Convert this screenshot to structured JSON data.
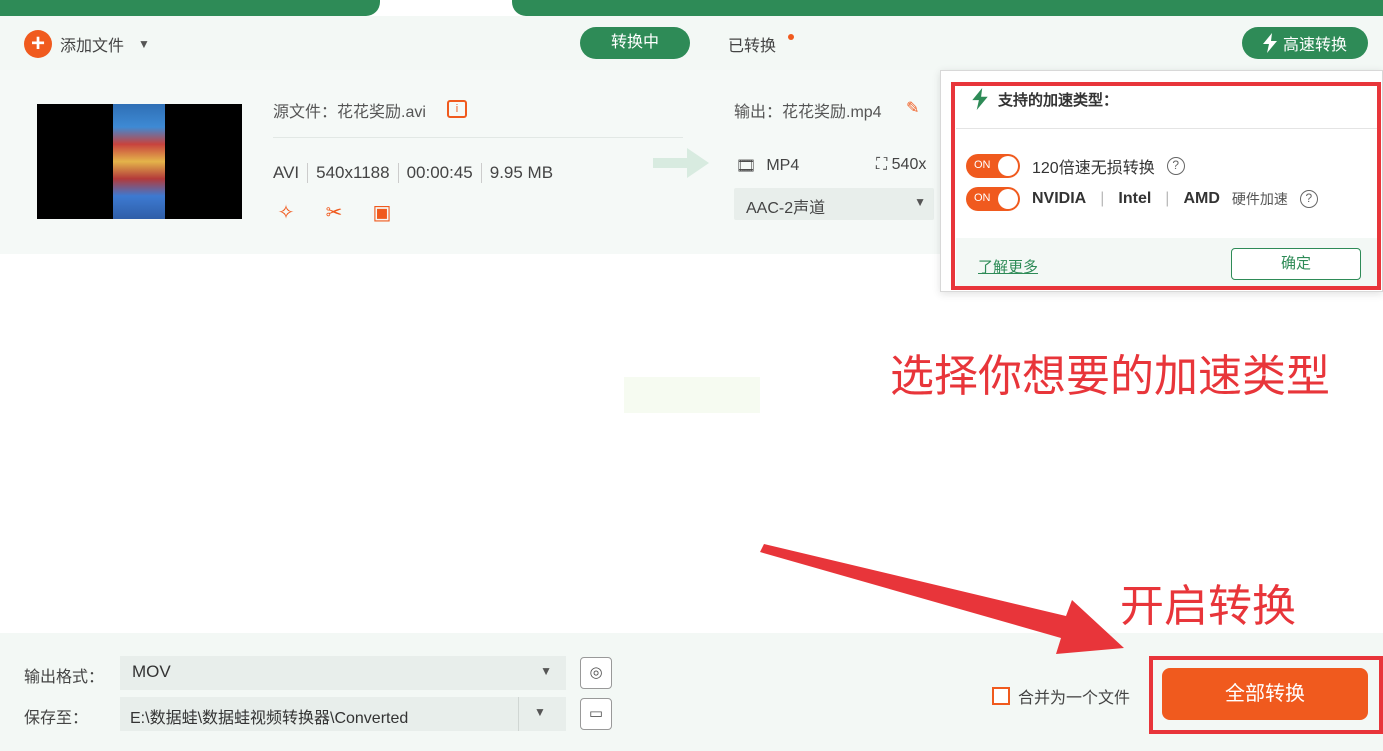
{
  "toolbar": {
    "add_file_label": "添加文件",
    "tab_converting": "转换中",
    "tab_converted": "已转换",
    "high_speed_label": "高速转换"
  },
  "file": {
    "source_label": "源文件：花花奖励.avi",
    "format": "AVI",
    "resolution": "540x1188",
    "duration": "00:00:45",
    "size": "9.95 MB",
    "output_label": "输出：花花奖励.mp4",
    "output_format": "MP4",
    "output_resolution": "540x",
    "audio": "AAC-2声道"
  },
  "popup": {
    "title": "支持的加速类型：",
    "option1_toggle": "ON",
    "option1_label": "120倍速无损转换",
    "option2_toggle": "ON",
    "option2_brands": [
      "NVIDIA",
      "Intel",
      "AMD"
    ],
    "option2_suffix": "硬件加速",
    "learn_more": "了解更多",
    "ok": "确定"
  },
  "annotations": {
    "note1": "选择你想要的加速类型",
    "note2": "开启转换"
  },
  "bottom": {
    "format_label": "输出格式：",
    "format_value": "MOV",
    "save_label": "保存至：",
    "save_path": "E:\\数据蛙\\数据蛙视频转换器\\Converted",
    "merge_label": "合并为一个文件",
    "convert_all": "全部转换"
  },
  "colors": {
    "green": "#2e8b57",
    "orange": "#f05a1e",
    "annotation_red": "#e8353a"
  }
}
